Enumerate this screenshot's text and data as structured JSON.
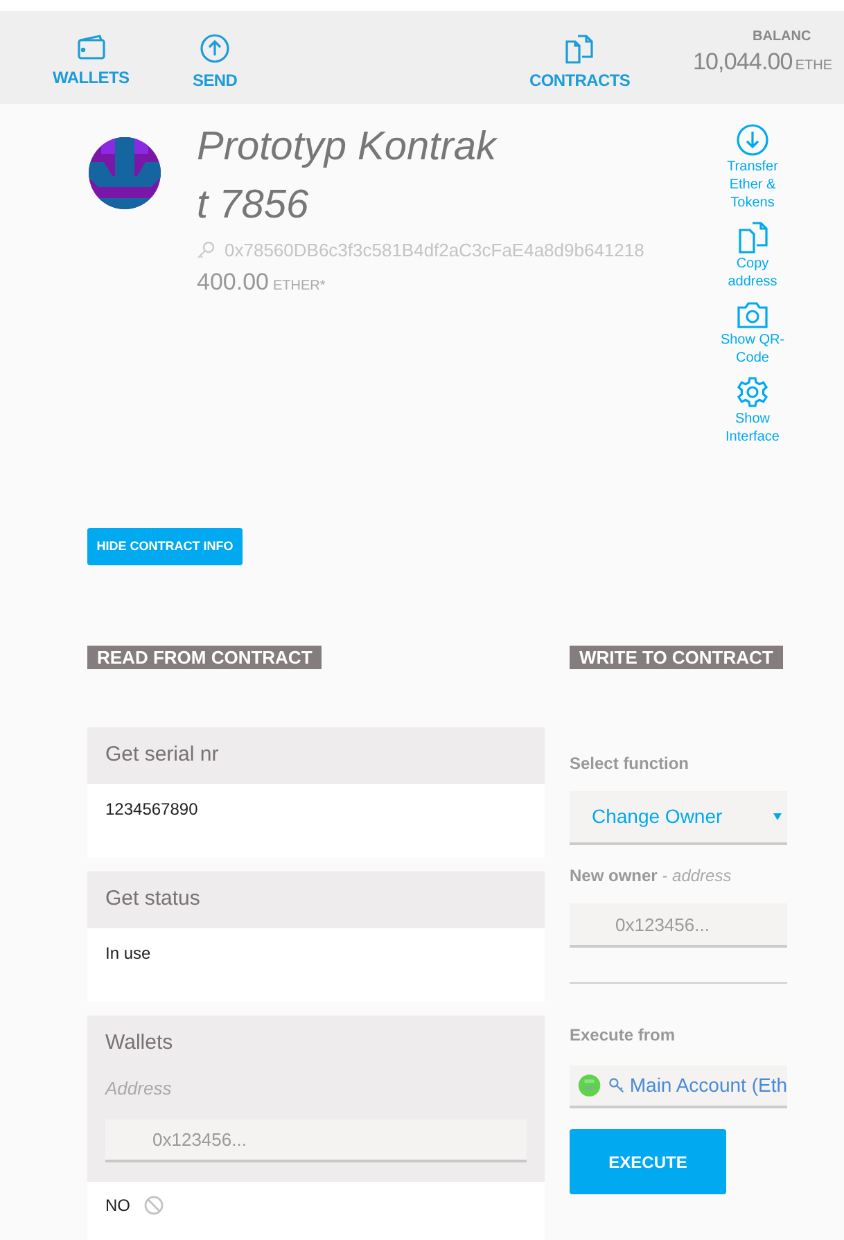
{
  "nav": {
    "items": [
      {
        "kind": "wallet",
        "label": "WALLETS"
      },
      {
        "kind": "send",
        "label": "SEND"
      },
      {
        "kind": "contracts",
        "label": "CONTRACTS"
      }
    ],
    "balance": {
      "label": "BALANC",
      "amount": "10,044.00",
      "unit": "ETHE"
    }
  },
  "contract": {
    "name": "Prototyp Kontrakt 7856",
    "address": "0x78560DB6c3f3c581B4df2aC3cFaE4a8d9b641218",
    "amount": "400.00",
    "unit": "ETHER*",
    "actions": [
      {
        "kind": "transfer",
        "label": "Transfer Ether & Tokens"
      },
      {
        "kind": "copy",
        "label": "Copy address"
      },
      {
        "kind": "qr",
        "label": "Show QR-Code"
      },
      {
        "kind": "interface",
        "label": "Show Interface"
      }
    ]
  },
  "hide_button": "HIDE CONTRACT INFO",
  "read": {
    "heading": "READ FROM CONTRACT",
    "functions": [
      {
        "kind": "output",
        "name": "Get serial nr",
        "result": "1234567890"
      },
      {
        "kind": "output",
        "name": "Get status",
        "result": "In use"
      },
      {
        "kind": "input",
        "name": "Wallets",
        "input_label": "Address",
        "placeholder": "0x123456...",
        "result": "NO"
      }
    ]
  },
  "write": {
    "heading": "WRITE TO CONTRACT",
    "select_label": "Select function",
    "selected_function": "Change Owner",
    "param_label": "**New owner** - *address*",
    "param_placeholder": "0x123456...",
    "execute_from_label": "Execute from",
    "account": "Main Account (Eth",
    "button": "EXECUTE"
  }
}
